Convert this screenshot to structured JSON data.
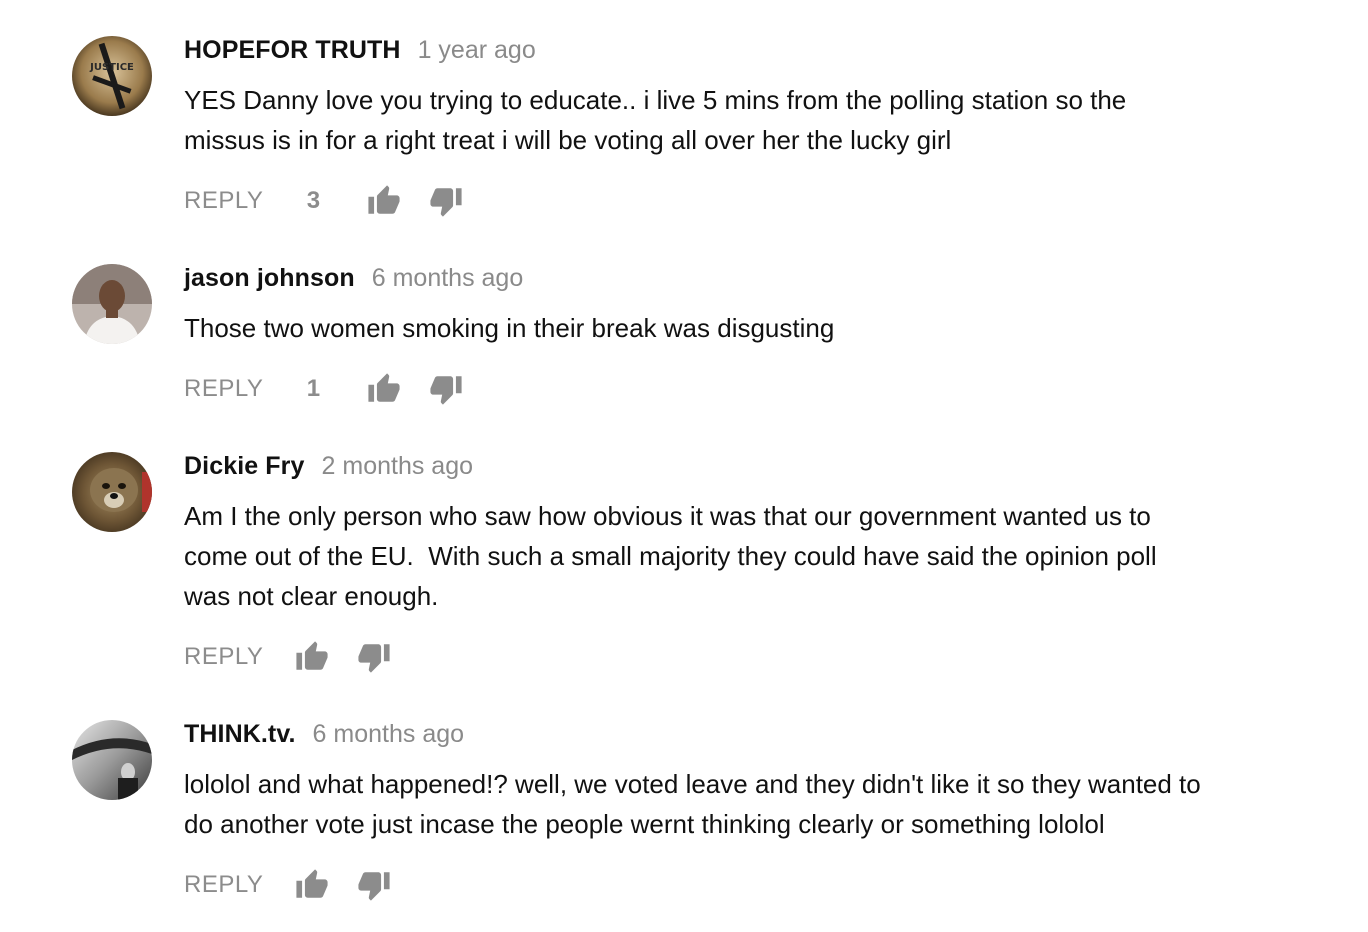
{
  "comments": [
    {
      "author": "HOPEFOR TRUTH",
      "time": "1 year ago",
      "text": "YES Danny love you trying to educate.. i live 5 mins from the polling station so the\nmissus is in for a right treat i will be voting all over her the lucky girl",
      "reply_label": "REPLY",
      "likes": "3",
      "avatar_text": "JUSTICE"
    },
    {
      "author": "jason johnson",
      "time": "6 months ago",
      "text": "Those two women smoking in their break was disgusting",
      "reply_label": "REPLY",
      "likes": "1"
    },
    {
      "author": "Dickie Fry",
      "time": "2 months ago",
      "text": "Am I the only person who saw how obvious it was that our government wanted us to\ncome out of the EU.  With such a small majority they could have said the opinion poll\nwas not clear enough.",
      "reply_label": "REPLY",
      "likes": ""
    },
    {
      "author": "THINK.tv.",
      "time": "6 months ago",
      "text": "lololol and what happened!? well, we voted leave and they didn't like it so they wanted to\ndo another vote just incase the people wernt thinking clearly or something lololol",
      "reply_label": "REPLY",
      "likes": ""
    }
  ],
  "icons": {
    "like": "thumb-up-icon",
    "dislike": "thumb-down-icon"
  },
  "colors": {
    "author": "#111111",
    "timestamp": "#8a8a8a",
    "action_gray": "#8c8c8c"
  }
}
